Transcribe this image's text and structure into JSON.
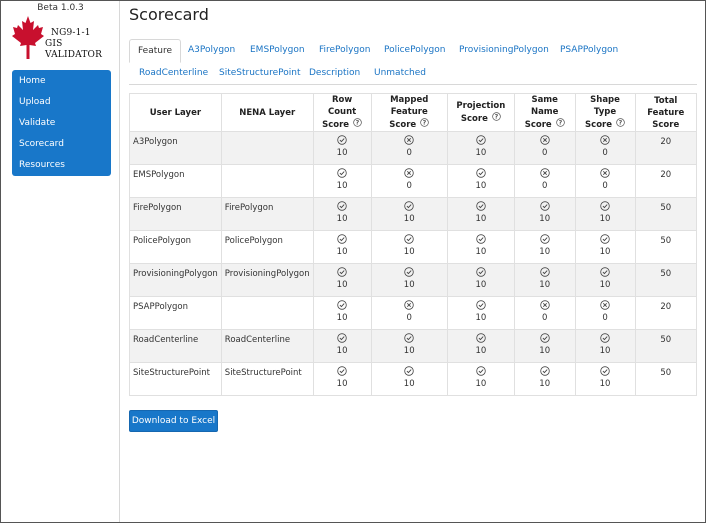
{
  "app": {
    "version": "Beta 1.0.3",
    "logo_line1": "NG9-1-1",
    "logo_line2": "GIS VALIDATOR"
  },
  "nav": {
    "items": [
      {
        "label": "Home"
      },
      {
        "label": "Upload"
      },
      {
        "label": "Validate"
      },
      {
        "label": "Scorecard"
      },
      {
        "label": "Resources"
      }
    ]
  },
  "page": {
    "title": "Scorecard"
  },
  "tabs": [
    {
      "label": "Feature",
      "active": true
    },
    {
      "label": "A3Polygon"
    },
    {
      "label": "EMSPolygon"
    },
    {
      "label": "FirePolygon"
    },
    {
      "label": "PolicePolygon"
    },
    {
      "label": "ProvisioningPolygon"
    },
    {
      "label": "PSAPPolygon"
    },
    {
      "label": "RoadCenterline"
    },
    {
      "label": "SiteStructurePoint"
    },
    {
      "label": "Description"
    },
    {
      "label": "Unmatched"
    }
  ],
  "table": {
    "headers": {
      "user_layer": "User Layer",
      "nena_layer": "NENA Layer",
      "row_count_1": "Row Count",
      "row_count_2": "Score",
      "mapped_1": "Mapped Feature",
      "mapped_2": "Score",
      "projection_1": "Projection",
      "projection_2": "Score",
      "same_name_1": "Same Name",
      "same_name_2": "Score",
      "shape_type_1": "Shape Type",
      "shape_type_2": "Score",
      "total_1": "Total Feature",
      "total_2": "Score"
    },
    "rows": [
      {
        "user": "A3Polygon",
        "nena": "",
        "row_count": "10",
        "mapped": "0",
        "projection": "10",
        "same_name": "0",
        "shape_type": "0",
        "total": "20"
      },
      {
        "user": "EMSPolygon",
        "nena": "",
        "row_count": "10",
        "mapped": "0",
        "projection": "10",
        "same_name": "0",
        "shape_type": "0",
        "total": "20"
      },
      {
        "user": "FirePolygon",
        "nena": "FirePolygon",
        "row_count": "10",
        "mapped": "10",
        "projection": "10",
        "same_name": "10",
        "shape_type": "10",
        "total": "50"
      },
      {
        "user": "PolicePolygon",
        "nena": "PolicePolygon",
        "row_count": "10",
        "mapped": "10",
        "projection": "10",
        "same_name": "10",
        "shape_type": "10",
        "total": "50"
      },
      {
        "user": "ProvisioningPolygon",
        "nena": "ProvisioningPolygon",
        "row_count": "10",
        "mapped": "10",
        "projection": "10",
        "same_name": "10",
        "shape_type": "10",
        "total": "50"
      },
      {
        "user": "PSAPPolygon",
        "nena": "",
        "row_count": "10",
        "mapped": "0",
        "projection": "10",
        "same_name": "0",
        "shape_type": "0",
        "total": "20"
      },
      {
        "user": "RoadCenterline",
        "nena": "RoadCenterline",
        "row_count": "10",
        "mapped": "10",
        "projection": "10",
        "same_name": "10",
        "shape_type": "10",
        "total": "50"
      },
      {
        "user": "SiteStructurePoint",
        "nena": "SiteStructurePoint",
        "row_count": "10",
        "mapped": "10",
        "projection": "10",
        "same_name": "10",
        "shape_type": "10",
        "total": "50"
      }
    ]
  },
  "actions": {
    "download_label": "Download to Excel"
  },
  "icons": {
    "pass": "check-circle-icon",
    "fail": "x-circle-icon",
    "help": "question-circle-icon"
  },
  "colors": {
    "accent": "#1877c9",
    "link": "#1a74c4",
    "leaf": "#c8102e"
  }
}
